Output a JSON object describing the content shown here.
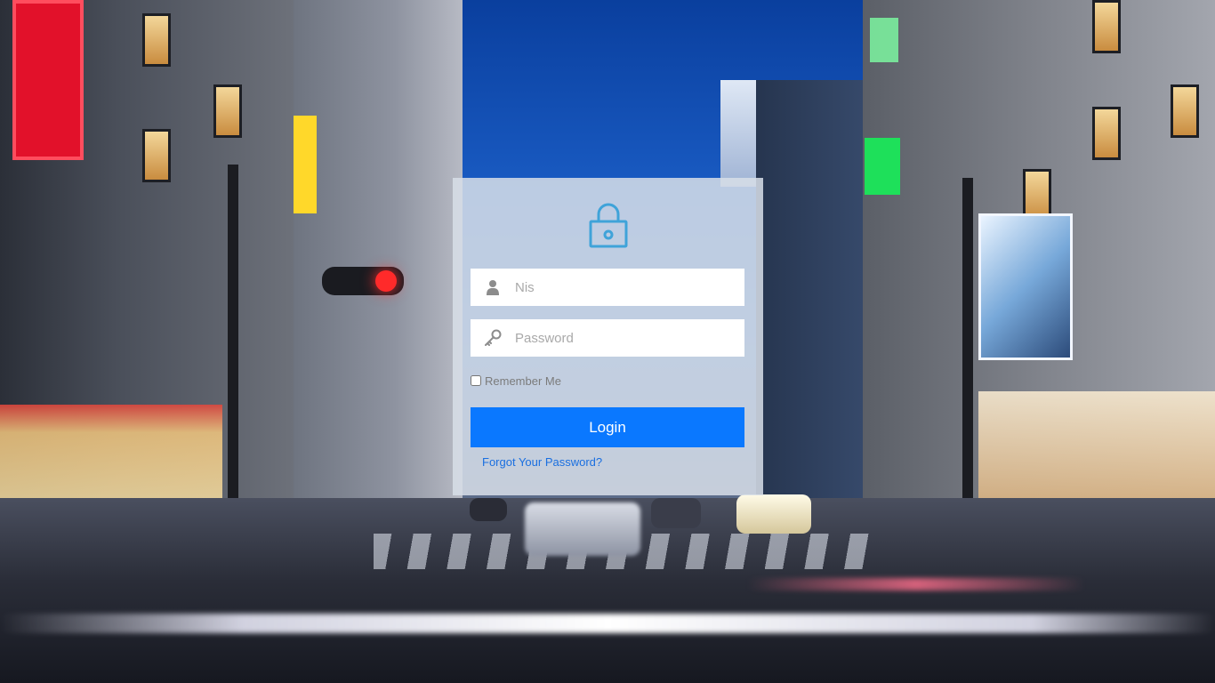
{
  "background": {
    "description_icon": "city-street-night-background"
  },
  "login": {
    "lock_icon": "lock-icon",
    "username_placeholder": "Nis",
    "username_icon": "user-icon",
    "password_placeholder": "Password",
    "password_icon": "key-icon",
    "remember_label": "Remember Me",
    "remember_checked": false,
    "button_label": "Login",
    "forgot_label": "Forgot Your Password?"
  },
  "colors": {
    "accent": "#0a78ff",
    "icon": "#3fa3d9",
    "link": "#1a6fe0",
    "card_bg": "rgba(215,222,232,0.86)"
  }
}
